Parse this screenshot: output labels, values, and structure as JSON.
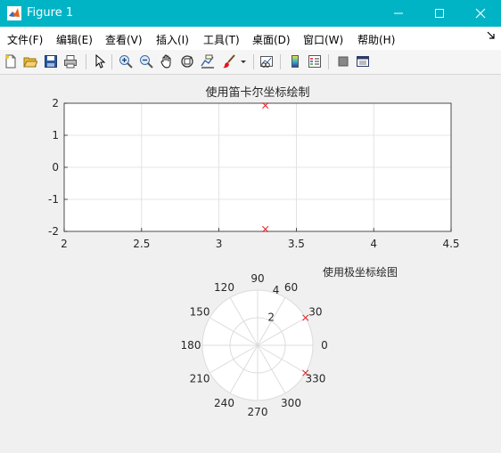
{
  "window": {
    "title": "Figure 1",
    "accent_color": "#00b4c6"
  },
  "menu": {
    "items": [
      {
        "label": "文件(F)"
      },
      {
        "label": "编辑(E)"
      },
      {
        "label": "查看(V)"
      },
      {
        "label": "插入(I)"
      },
      {
        "label": "工具(T)"
      },
      {
        "label": "桌面(D)"
      },
      {
        "label": "窗口(W)"
      },
      {
        "label": "帮助(H)"
      }
    ],
    "overflow_icon": "undock-arrow-icon"
  },
  "toolbar": {
    "buttons": [
      "new-figure-icon",
      "open-file-icon",
      "save-icon",
      "print-icon",
      "pointer-icon",
      "zoom-in-icon",
      "zoom-out-icon",
      "pan-icon",
      "rotate-3d-icon",
      "data-cursor-icon",
      "brush-icon",
      "link-plot-icon",
      "colorbar-icon",
      "legend-icon",
      "hide-plot-tools-icon",
      "show-plot-tools-icon"
    ]
  },
  "chart_data": [
    {
      "type": "scatter",
      "title": "使用笛卡尔坐标绘制",
      "xlim": [
        2,
        4.5
      ],
      "ylim": [
        -2,
        2
      ],
      "xticks": [
        "2",
        "2.5",
        "3",
        "3.5",
        "4",
        "4.5"
      ],
      "yticks": [
        "2",
        "1",
        "0",
        "-1",
        "-2"
      ],
      "xtick_values": [
        2,
        2.5,
        3,
        3.5,
        4,
        4.5
      ],
      "ytick_values": [
        2,
        1,
        0,
        -1,
        -2
      ],
      "grid": true,
      "marker": "x",
      "marker_color": "#e8121b",
      "points": [
        {
          "x": 3.3,
          "y": 1.93
        },
        {
          "x": 3.3,
          "y": -1.93
        }
      ]
    },
    {
      "type": "polar",
      "title": "使用极坐标绘图",
      "rmax": 4,
      "rticks": [
        "2",
        "4"
      ],
      "angle_ticks": [
        "0",
        "30",
        "60",
        "90",
        "120",
        "150",
        "180",
        "210",
        "240",
        "270",
        "300",
        "330"
      ],
      "angle_values": [
        0,
        30,
        60,
        90,
        120,
        150,
        180,
        210,
        240,
        270,
        300,
        330
      ],
      "grid": true,
      "marker": "x",
      "marker_color": "#e8121b",
      "points": [
        {
          "theta_deg": 30,
          "r": 4
        },
        {
          "theta_deg": -30,
          "r": 4
        }
      ]
    }
  ]
}
